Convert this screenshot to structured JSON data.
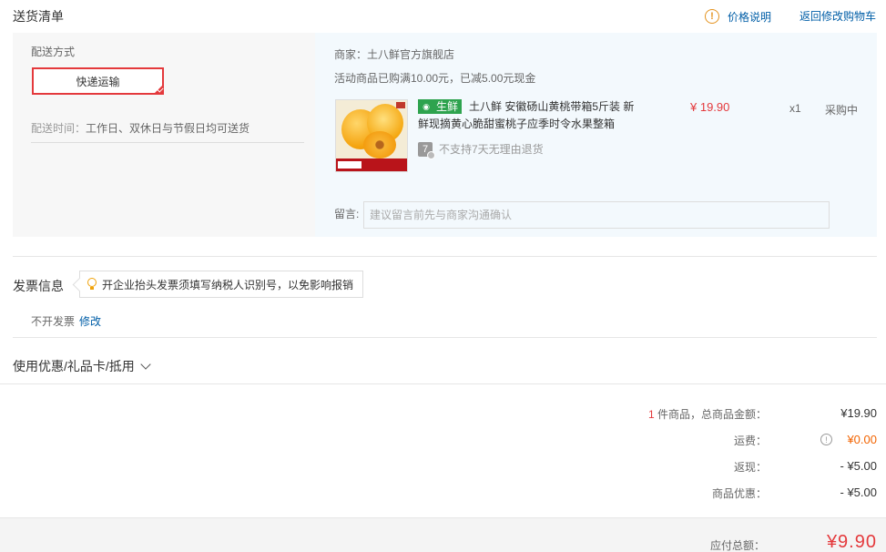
{
  "header": {
    "title": "送货清单",
    "price_note": "价格说明",
    "back_link": "返回修改购物车"
  },
  "shipping": {
    "method_label": "配送方式",
    "method_selected": "快递运输",
    "time_label": "配送时间：",
    "time_value": "工作日、双休日与节假日均可送货"
  },
  "goods": {
    "merchant": "商家：土八鲜官方旗舰店",
    "promo": "活动商品已购满10.00元，已减5.00元现金",
    "tag": "生鲜",
    "product_name": "土八鲜 安徽砀山黄桃带箱5斤装 新鲜现摘黄心脆甜蜜桃子应季时令水果整箱",
    "no_return": "不支持7天无理由退货",
    "seven_badge": "7",
    "price": "¥ 19.90",
    "quantity": "x1",
    "stock_status": "采购中",
    "remark_label": "留言:",
    "remark_placeholder": "建议留言前先与商家沟通确认"
  },
  "invoice": {
    "title": "发票信息",
    "tip": "开企业抬头发票须填写纳税人识别号，以免影响报销",
    "status": "不开发票",
    "edit": "修改"
  },
  "coupon": {
    "label": "使用优惠/礼品卡/抵用"
  },
  "summary": {
    "item_count": "1",
    "items_label": " 件商品，总商品金额：",
    "items_total": "¥19.90",
    "freight_label": "运费：",
    "freight_value": "¥0.00",
    "cashback_label": "返现：",
    "cashback_value": "- ¥5.00",
    "discount_label": "商品优惠：",
    "discount_value": "- ¥5.00",
    "payable_label": "应付总额：",
    "payable_value": "¥9.90"
  },
  "colors": {
    "accent_red": "#e4393c",
    "link_blue": "#005ea7",
    "fresh_green": "#2ea34e",
    "freight_orange": "#f26300"
  }
}
